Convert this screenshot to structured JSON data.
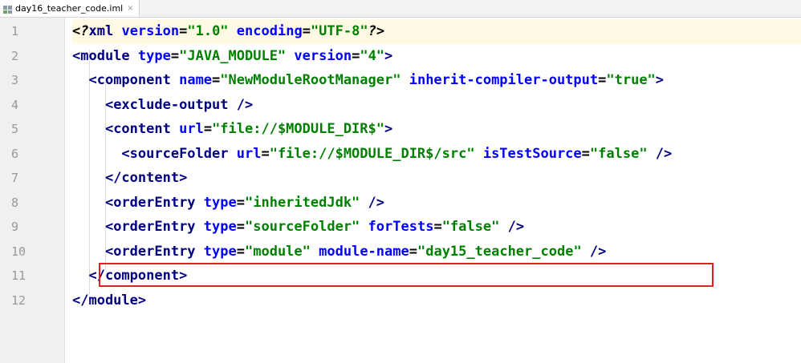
{
  "tab": {
    "filename": "day16_teacher_code.iml",
    "close_glyph": "×"
  },
  "line_numbers": [
    "1",
    "2",
    "3",
    "4",
    "5",
    "6",
    "7",
    "8",
    "9",
    "10",
    "11",
    "12"
  ],
  "code": {
    "l1": {
      "indent": "",
      "open": "<?",
      "tag": "xml",
      "a1": "version",
      "v1": "\"1.0\"",
      "a2": "encoding",
      "v2": "\"UTF-8\"",
      "close": "?>"
    },
    "l2": {
      "indent": "",
      "tag": "<module",
      "a1": "type",
      "v1": "\"JAVA_MODULE\"",
      "a2": "version",
      "v2": "\"4\"",
      "close": ">"
    },
    "l3": {
      "indent": "  ",
      "tag": "<component",
      "a1": "name",
      "v1": "\"NewModuleRootManager\"",
      "a2": "inherit-compiler-output",
      "v2": "\"true\"",
      "close": ">"
    },
    "l4": {
      "indent": "    ",
      "tag": "<exclude-output",
      "close": " />"
    },
    "l5": {
      "indent": "    ",
      "tag": "<content",
      "a1": "url",
      "v1": "\"file://$MODULE_DIR$\"",
      "close": ">"
    },
    "l6": {
      "indent": "      ",
      "tag": "<sourceFolder",
      "a1": "url",
      "v1": "\"file://$MODULE_DIR$/src\"",
      "a2": "isTestSource",
      "v2": "\"false\"",
      "close": " />"
    },
    "l7": {
      "indent": "    ",
      "tag": "</content>"
    },
    "l8": {
      "indent": "    ",
      "tag": "<orderEntry",
      "a1": "type",
      "v1": "\"inheritedJdk\"",
      "close": " />"
    },
    "l9": {
      "indent": "    ",
      "tag": "<orderEntry",
      "a1": "type",
      "v1": "\"sourceFolder\"",
      "a2": "forTests",
      "v2": "\"false\"",
      "close": " />"
    },
    "l10": {
      "indent": "    ",
      "tag": "<orderEntry",
      "a1": "type",
      "v1": "\"module\"",
      "a2": "module-name",
      "v2": "\"day15_teacher_code\"",
      "close": " />"
    },
    "l11": {
      "indent": "  ",
      "tag": "</component>"
    },
    "l12": {
      "indent": "",
      "tag": "</module>"
    }
  },
  "colors": {
    "tag": "#000080",
    "attribute": "#0000ff",
    "value": "#008000",
    "highlight_border": "#e41f1f",
    "current_line": "#fffae3"
  }
}
